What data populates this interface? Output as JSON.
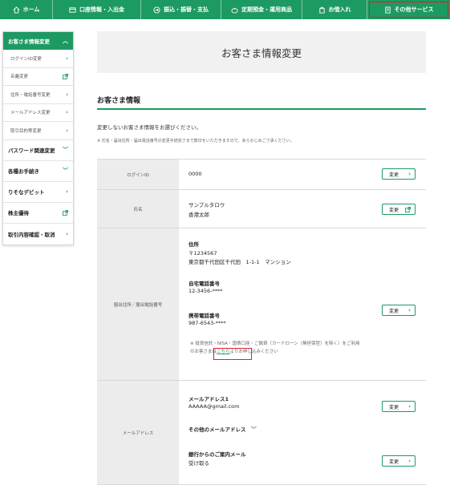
{
  "topnav": [
    {
      "label": "ホーム",
      "icon": "home-icon"
    },
    {
      "label": "口座情報・入出金",
      "icon": "account-icon"
    },
    {
      "label": "振込・振替・支払",
      "icon": "transfer-icon"
    },
    {
      "label": "定期預金・運用商品",
      "icon": "deposit-icon"
    },
    {
      "label": "お借入れ",
      "icon": "loan-icon"
    },
    {
      "label": "その他サービス",
      "icon": "services-icon"
    }
  ],
  "sidebar": {
    "head": "お客さま情報変更",
    "subitems": [
      {
        "label": "ログインID変更"
      },
      {
        "label": "名義変更"
      },
      {
        "label": "住所・電話番号変更"
      },
      {
        "label": "メールアドレス変更"
      },
      {
        "label": "取引目的等変更"
      }
    ],
    "mainitems": [
      {
        "label": "パスワード関連変更"
      },
      {
        "label": "各種お手続き"
      },
      {
        "label": "りそなデビット"
      },
      {
        "label": "株主優待"
      },
      {
        "label": "取引内容確認・取消"
      }
    ]
  },
  "page": {
    "title": "お客さま情報変更",
    "section_title": "お客さま情報",
    "intro": "変更しないお客さま情報をお選びください。",
    "note": "※ 氏名・届出住所・届出電話番号の変更手続完了まで数日をいただきますので、あらかじめご了承ください。"
  },
  "table": {
    "login": {
      "label": "ログインID",
      "value": "0000",
      "button": "変更"
    },
    "name": {
      "label": "氏名",
      "kana": "サンプルタロウ",
      "kanji": "香港太郎",
      "button": "変更"
    },
    "address": {
      "label": "届出住所／届出電話番号",
      "addr_title": "住所",
      "zip": "〒1234567",
      "addr": "東京都千代田区千代田　1-1-1　マンション",
      "home_title": "自宅電話番号",
      "home": "12-3456-****",
      "mobile_title": "携帯電話番号",
      "mobile": "987-6543-****",
      "note_a": "※ 投資信託・NISA・国債口座・ご融資（カードローン（無担保型）を除く）をご利用",
      "note_b1": "のお客さまは",
      "note_link": "こちら",
      "note_b2": "よりお申し込みください",
      "button": "変更"
    },
    "email": {
      "label": "メールアドレス",
      "mail1_title": "メールアドレス1",
      "mail1": "AAAAA@gmail.com",
      "other_title": "その他のメールアドレス",
      "bank_title": "銀行からのご案内メール",
      "bank_value": "受け取る",
      "button": "変更"
    }
  }
}
